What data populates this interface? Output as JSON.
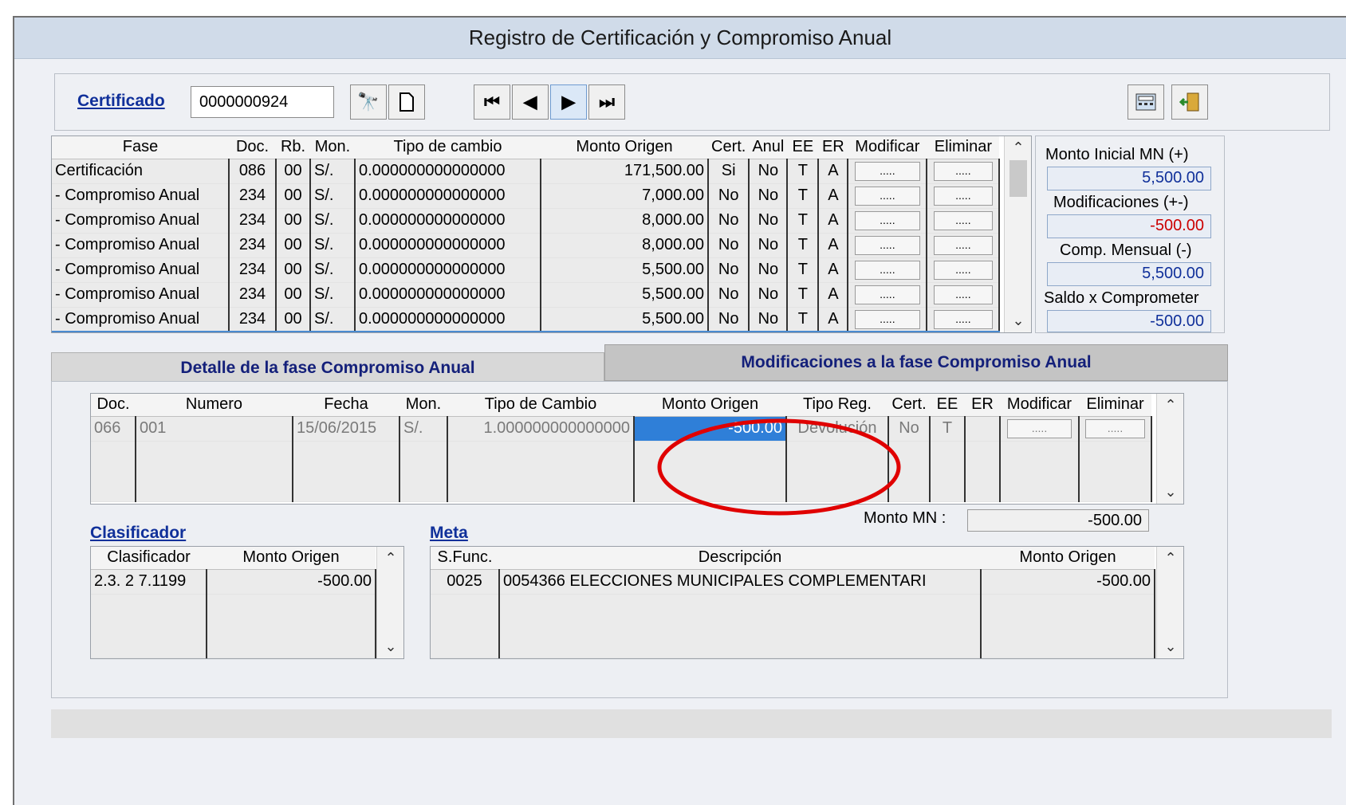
{
  "window": {
    "title": "Registro de Certificación y Compromiso Anual"
  },
  "toolbar": {
    "cert_label": "Certificado",
    "cert_value": "0000000924",
    "icons": [
      "binoculars-icon",
      "new-document-icon",
      "first-record-icon",
      "prev-record-icon",
      "next-record-icon",
      "last-record-icon",
      "calculator-icon",
      "exit-door-icon"
    ]
  },
  "phases": {
    "headers": [
      "Fase",
      "Doc.",
      "Rb.",
      "Mon.",
      "Tipo de cambio",
      "Monto Origen",
      "Cert.",
      "Anul",
      "EE",
      "ER",
      "Modificar",
      "Eliminar"
    ],
    "rows": [
      [
        "Certificación",
        "086",
        "00",
        "S/.",
        "0.000000000000000",
        "171,500.00",
        "Si",
        "No",
        "T",
        "A",
        ".....",
        "....."
      ],
      [
        " - Compromiso Anual",
        "234",
        "00",
        "S/.",
        "0.000000000000000",
        "7,000.00",
        "No",
        "No",
        "T",
        "A",
        ".....",
        "....."
      ],
      [
        " - Compromiso Anual",
        "234",
        "00",
        "S/.",
        "0.000000000000000",
        "8,000.00",
        "No",
        "No",
        "T",
        "A",
        ".....",
        "....."
      ],
      [
        " - Compromiso Anual",
        "234",
        "00",
        "S/.",
        "0.000000000000000",
        "8,000.00",
        "No",
        "No",
        "T",
        "A",
        ".....",
        "....."
      ],
      [
        " - Compromiso Anual",
        "234",
        "00",
        "S/.",
        "0.000000000000000",
        "5,500.00",
        "No",
        "No",
        "T",
        "A",
        ".....",
        "....."
      ],
      [
        " - Compromiso Anual",
        "234",
        "00",
        "S/.",
        "0.000000000000000",
        "5,500.00",
        "No",
        "No",
        "T",
        "A",
        ".....",
        "....."
      ],
      [
        " - Compromiso Anual",
        "234",
        "00",
        "S/.",
        "0.000000000000000",
        "5,500.00",
        "No",
        "No",
        "T",
        "A",
        ".....",
        "....."
      ]
    ]
  },
  "summary": {
    "monto_inicial_label": "Monto Inicial MN (+)",
    "monto_inicial_value": "5,500.00",
    "modificaciones_label": "Modificaciones (+-)",
    "modificaciones_value": "-500.00",
    "comp_mensual_label": "Comp. Mensual (-)",
    "comp_mensual_value": "5,500.00",
    "saldo_label": "Saldo x Comprometer",
    "saldo_value": "-500.00",
    "negative_color": "#cc0000"
  },
  "tabs": {
    "detalle": "Detalle de la fase Compromiso Anual",
    "modificaciones": "Modificaciones a la fase Compromiso Anual"
  },
  "modifications": {
    "headers": [
      "Doc.",
      "Numero",
      "Fecha",
      "Mon.",
      "Tipo de Cambio",
      "Monto Origen",
      "Tipo Reg.",
      "Cert.",
      "EE",
      "ER",
      "Modificar",
      "Eliminar"
    ],
    "rows": [
      [
        "066",
        "001",
        "15/06/2015",
        "S/.",
        "1.000000000000000",
        "-500.00",
        "Devolución",
        "No",
        "T",
        "",
        ".....",
        "....."
      ]
    ],
    "monto_mn_label": "Monto  MN :",
    "monto_mn_value": "-500.00"
  },
  "clasificador": {
    "section_label": "Clasificador",
    "headers": [
      "Clasificador",
      "Monto Origen"
    ],
    "rows": [
      [
        "2.3. 2 7.1199",
        "-500.00"
      ]
    ]
  },
  "meta": {
    "section_label": "Meta",
    "headers": [
      "S.Func.",
      "Descripción",
      "Monto Origen"
    ],
    "rows": [
      [
        "0025",
        "0054366  ELECCIONES MUNICIPALES COMPLEMENTARI",
        "-500.00"
      ]
    ]
  },
  "annotation": {
    "color": "#e00000",
    "shape": "ellipse"
  }
}
